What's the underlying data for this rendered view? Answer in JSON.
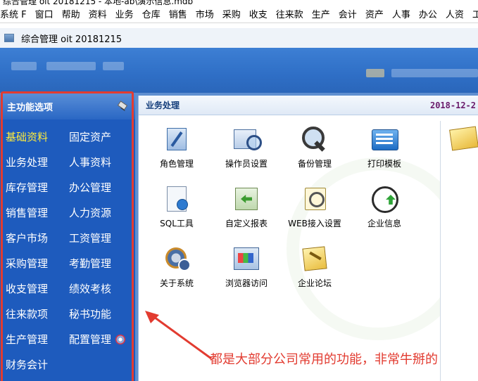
{
  "app": {
    "window_title": "综合管理 oit 20181215 - 本地-ab\\演示信息.mdb",
    "subwindow_title": "综合管理 oit 20181215"
  },
  "menubar": {
    "items": [
      "系统 F",
      "窗口",
      "帮助",
      "资料",
      "业务",
      "仓库",
      "销售",
      "市场",
      "采购",
      "收支",
      "往来款",
      "生产",
      "会计",
      "资产",
      "人事",
      "办公",
      "人资",
      "工"
    ]
  },
  "sidebar": {
    "title": "主功能选项",
    "items": [
      {
        "label": "基础资料",
        "active": true
      },
      {
        "label": "固定资产",
        "active": false
      },
      {
        "label": "业务处理",
        "active": false
      },
      {
        "label": "人事资料",
        "active": false
      },
      {
        "label": "库存管理",
        "active": false
      },
      {
        "label": "办公管理",
        "active": false
      },
      {
        "label": "销售管理",
        "active": false
      },
      {
        "label": "人力资源",
        "active": false
      },
      {
        "label": "客户市场",
        "active": false
      },
      {
        "label": "工资管理",
        "active": false
      },
      {
        "label": "采购管理",
        "active": false
      },
      {
        "label": "考勤管理",
        "active": false
      },
      {
        "label": "收支管理",
        "active": false
      },
      {
        "label": "绩效考核",
        "active": false
      },
      {
        "label": "往来款项",
        "active": false
      },
      {
        "label": "秘书功能",
        "active": false
      },
      {
        "label": "生产管理",
        "active": false
      },
      {
        "label": "配置管理",
        "active": false
      },
      {
        "label": "财务会计",
        "active": false
      }
    ]
  },
  "panel": {
    "title": "业务处理",
    "date": "2018-12-2",
    "icons": [
      {
        "label": "角色管理",
        "icon": "role-icon"
      },
      {
        "label": "操作员设置",
        "icon": "operator-icon"
      },
      {
        "label": "备份管理",
        "icon": "backup-icon"
      },
      {
        "label": "打印模板",
        "icon": "print-template-icon"
      },
      {
        "label": "SQL工具",
        "icon": "sql-tool-icon"
      },
      {
        "label": "自定义报表",
        "icon": "custom-report-icon"
      },
      {
        "label": "WEB接入设置",
        "icon": "web-access-icon"
      },
      {
        "label": "企业信息",
        "icon": "company-info-icon"
      },
      {
        "label": "关于系统",
        "icon": "about-icon"
      },
      {
        "label": "浏览器访问",
        "icon": "browser-icon"
      },
      {
        "label": "企业论坛",
        "icon": "forum-icon"
      }
    ]
  },
  "annotation": {
    "text": "都是大部分公司常用的功能，非常牛掰的",
    "color": "#e23b30"
  },
  "colors": {
    "sidebar_bg": "#1e5bbd",
    "active_item": "#ffeb3b",
    "banner": "#3d7fd4",
    "date_color": "#6a1b6b"
  }
}
